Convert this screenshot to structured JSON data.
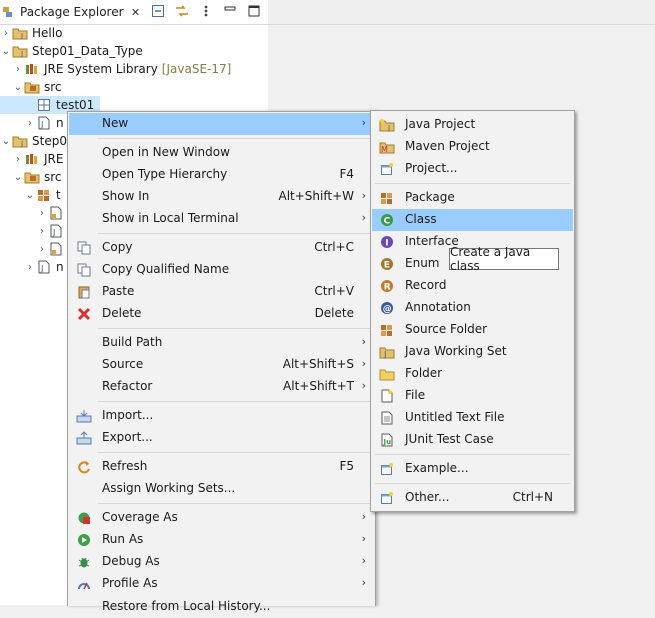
{
  "view": {
    "tab_title": "Package Explorer",
    "close_symbol": "✕"
  },
  "tree": {
    "rows": [
      {
        "label": "Hello",
        "extra": ""
      },
      {
        "label": "Step01_Data_Type",
        "extra": ""
      },
      {
        "label": "JRE System Library",
        "extra": "[JavaSE-17]"
      },
      {
        "label": "src",
        "extra": ""
      },
      {
        "label": "test01",
        "extra": ""
      },
      {
        "label": "n",
        "extra": ""
      },
      {
        "label": "Step01",
        "extra": ""
      },
      {
        "label": "JRE",
        "extra": ""
      },
      {
        "label": "src",
        "extra": ""
      },
      {
        "label": "t",
        "extra": ""
      },
      {
        "label": "",
        "extra": ""
      },
      {
        "label": "",
        "extra": ""
      },
      {
        "label": "",
        "extra": ""
      },
      {
        "label": "n",
        "extra": ""
      }
    ]
  },
  "context_menu": {
    "items": [
      {
        "label": "New",
        "shortcut": "",
        "arrow": "›"
      },
      {
        "label": "Open in New Window",
        "shortcut": ""
      },
      {
        "label": "Open Type Hierarchy",
        "shortcut": "F4"
      },
      {
        "label": "Show In",
        "shortcut": "Alt+Shift+W",
        "arrow": "›"
      },
      {
        "label": "Show in Local Terminal",
        "shortcut": "",
        "arrow": "›"
      },
      {
        "label": "Copy",
        "shortcut": "Ctrl+C"
      },
      {
        "label": "Copy Qualified Name",
        "shortcut": ""
      },
      {
        "label": "Paste",
        "shortcut": "Ctrl+V"
      },
      {
        "label": "Delete",
        "shortcut": "Delete"
      },
      {
        "label": "Build Path",
        "shortcut": "",
        "arrow": "›"
      },
      {
        "label": "Source",
        "shortcut": "Alt+Shift+S",
        "arrow": "›"
      },
      {
        "label": "Refactor",
        "shortcut": "Alt+Shift+T",
        "arrow": "›"
      },
      {
        "label": "Import...",
        "shortcut": ""
      },
      {
        "label": "Export...",
        "shortcut": ""
      },
      {
        "label": "Refresh",
        "shortcut": "F5"
      },
      {
        "label": "Assign Working Sets...",
        "shortcut": ""
      },
      {
        "label": "Coverage As",
        "shortcut": "",
        "arrow": "›"
      },
      {
        "label": "Run As",
        "shortcut": "",
        "arrow": "›"
      },
      {
        "label": "Debug As",
        "shortcut": "",
        "arrow": "›"
      },
      {
        "label": "Profile As",
        "shortcut": "",
        "arrow": "›"
      },
      {
        "label": "Restore from Local History...",
        "shortcut": ""
      }
    ]
  },
  "submenu": {
    "items": [
      {
        "label": "Java Project",
        "shortcut": ""
      },
      {
        "label": "Maven Project",
        "shortcut": ""
      },
      {
        "label": "Project...",
        "shortcut": ""
      },
      {
        "label": "Package",
        "shortcut": ""
      },
      {
        "label": "Class",
        "shortcut": ""
      },
      {
        "label": "Interface",
        "shortcut": ""
      },
      {
        "label": "Enum",
        "shortcut": ""
      },
      {
        "label": "Record",
        "shortcut": ""
      },
      {
        "label": "Annotation",
        "shortcut": ""
      },
      {
        "label": "Source Folder",
        "shortcut": ""
      },
      {
        "label": "Java Working Set",
        "shortcut": ""
      },
      {
        "label": "Folder",
        "shortcut": ""
      },
      {
        "label": "File",
        "shortcut": ""
      },
      {
        "label": "Untitled Text File",
        "shortcut": ""
      },
      {
        "label": "JUnit Test Case",
        "shortcut": ""
      },
      {
        "label": "Example...",
        "shortcut": ""
      },
      {
        "label": "Other...",
        "shortcut": "Ctrl+N"
      }
    ]
  },
  "tooltip": {
    "text": "Create a Java class"
  },
  "colors": {
    "highlight": "#99ccff",
    "selection": "#cce8ff"
  }
}
